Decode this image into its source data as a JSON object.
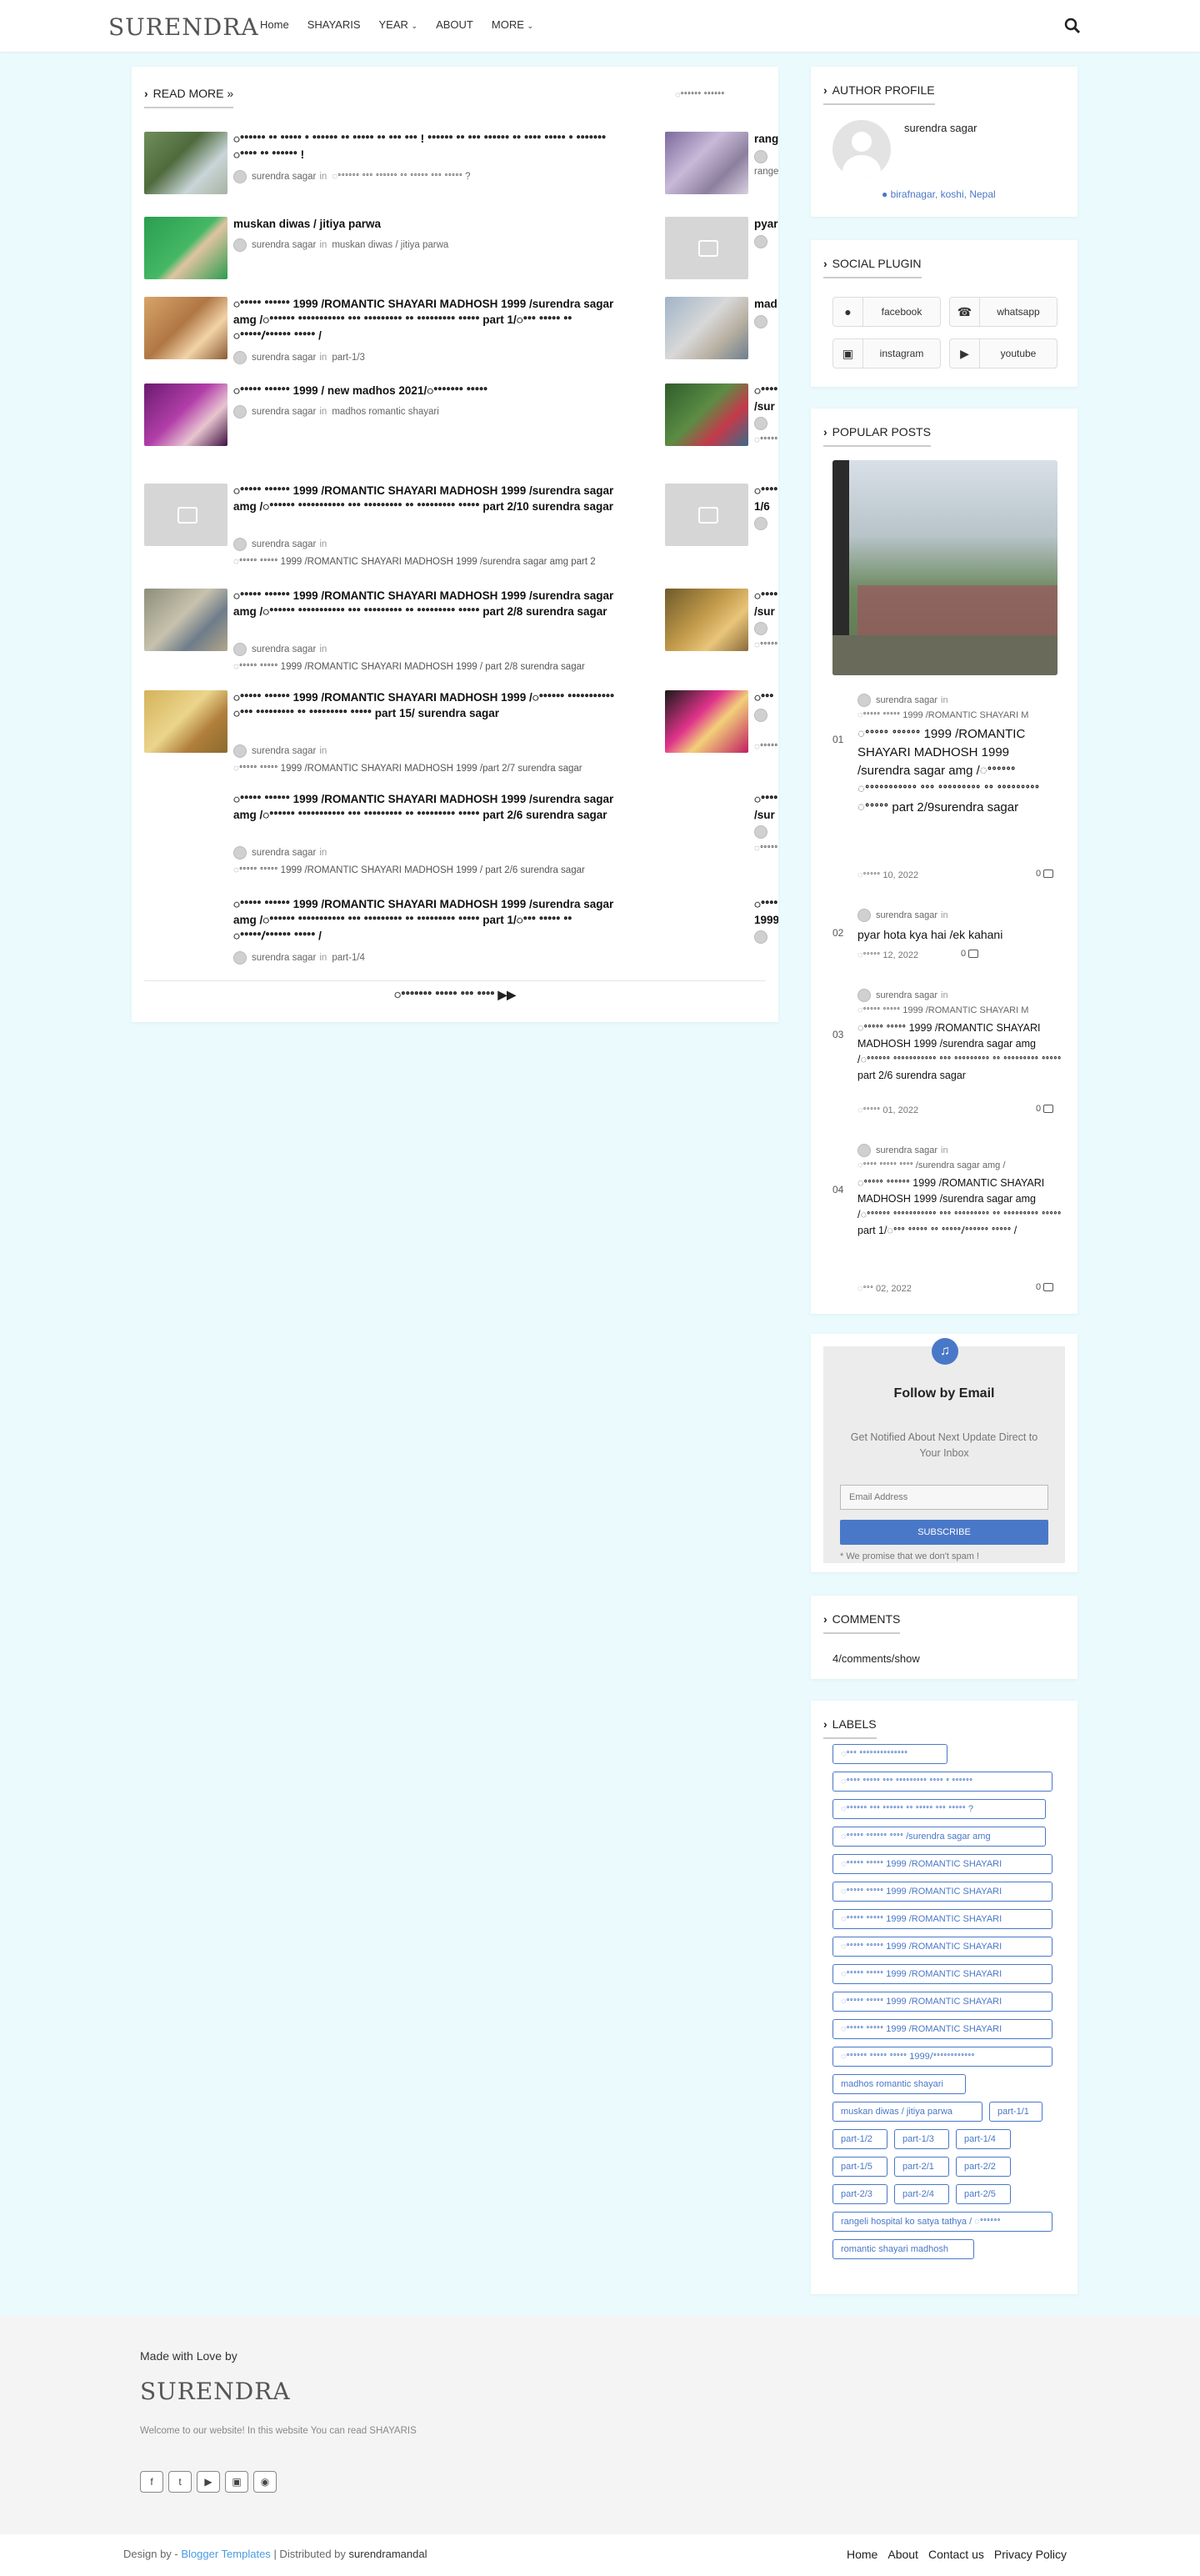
{
  "header": {
    "logo": "SURENDRA",
    "nav": [
      "Home",
      "SHAYARIS",
      "YEAR",
      "ABOUT",
      "MORE"
    ],
    "nav_has_dropdown": [
      false,
      false,
      true,
      false,
      true
    ]
  },
  "main": {
    "section_title": "READ MORE »",
    "section_link": "ꢀꢀꢀꢀꢀꢀ ꢀꢀꢀꢀꢀꢀ",
    "left_posts": [
      {
        "title": "ꢀꢀꢀꢀꢀꢀ ꢀꢀ ꢀꢀꢀꢀꢀ ꢀ ꢀꢀꢀꢀꢀꢀ ꢀꢀ ꢀꢀꢀꢀꢀ ꢀꢀ ꢀꢀꢀ ꢀꢀꢀ ! ꢀꢀꢀꢀꢀꢀ ꢀꢀ ꢀꢀꢀ ꢀꢀꢀꢀꢀꢀ ꢀꢀ ꢀꢀꢀꢀ ꢀꢀꢀꢀꢀ ꢀ ꢀꢀꢀꢀꢀꢀꢀ ꢀꢀꢀꢀ ꢀꢀ ꢀꢀꢀꢀꢀꢀ !",
        "author": "surendra sagar",
        "label": "ꢀꢀꢀꢀꢀꢀ ꢀꢀꢀ ꢀꢀꢀꢀꢀꢀ ꢀꢀ ꢀꢀꢀꢀꢀ ꢀꢀꢀ ꢀꢀꢀꢀꢀ ?"
      },
      {
        "title": "muskan diwas / jitiya parwa",
        "author": "surendra sagar",
        "label": "muskan diwas / jitiya parwa"
      },
      {
        "title": "ꢀꢀꢀꢀꢀ ꢀꢀꢀꢀꢀꢀ 1999 /ROMANTIC SHAYARI MADHOSH 1999 /surendra sagar amg /ꢀꢀꢀꢀꢀꢀ ꢀꢀꢀꢀꢀꢀꢀꢀꢀꢀꢀ ꢀꢀꢀ ꢀꢀꢀꢀꢀꢀꢀꢀꢀ ꢀꢀ ꢀꢀꢀꢀꢀꢀꢀꢀꢀ ꢀꢀꢀꢀꢀ part 1/ꢀꢀꢀ ꢀꢀꢀꢀꢀ ꢀꢀ ꢀꢀꢀꢀꢀ/ꢀꢀꢀꢀꢀꢀ ꢀꢀꢀꢀꢀ /",
        "author": "surendra sagar",
        "label": "part-1/3"
      },
      {
        "title": "ꢀꢀꢀꢀꢀ ꢀꢀꢀꢀꢀꢀ 1999 / new madhos 2021/ꢀꢀꢀꢀꢀꢀꢀ ꢀꢀꢀꢀꢀ",
        "author": "surendra sagar",
        "label": "madhos romantic shayari"
      },
      {
        "title": "ꢀꢀꢀꢀꢀ ꢀꢀꢀꢀꢀꢀ 1999 /ROMANTIC SHAYARI MADHOSH 1999 /surendra sagar amg /ꢀꢀꢀꢀꢀꢀ ꢀꢀꢀꢀꢀꢀꢀꢀꢀꢀꢀ ꢀꢀꢀ ꢀꢀꢀꢀꢀꢀꢀꢀꢀ ꢀꢀ ꢀꢀꢀꢀꢀꢀꢀꢀꢀ ꢀꢀꢀꢀꢀ part 2/10 surendra sagar",
        "author": "surendra sagar",
        "label": "ꢀꢀꢀꢀꢀ ꢀꢀꢀꢀꢀ 1999 /ROMANTIC SHAYARI MADHOSH 1999 /surendra sagar amg part 2"
      },
      {
        "title": "ꢀꢀꢀꢀꢀ ꢀꢀꢀꢀꢀꢀ 1999 /ROMANTIC SHAYARI MADHOSH 1999 /surendra sagar amg /ꢀꢀꢀꢀꢀꢀ ꢀꢀꢀꢀꢀꢀꢀꢀꢀꢀꢀ ꢀꢀꢀ ꢀꢀꢀꢀꢀꢀꢀꢀꢀ ꢀꢀ ꢀꢀꢀꢀꢀꢀꢀꢀꢀ ꢀꢀꢀꢀꢀ part 2/8 surendra sagar",
        "author": "surendra sagar",
        "label": "ꢀꢀꢀꢀꢀ ꢀꢀꢀꢀꢀ 1999 /ROMANTIC SHAYARI MADHOSH 1999 / part 2/8 surendra sagar"
      },
      {
        "title": "ꢀꢀꢀꢀꢀ ꢀꢀꢀꢀꢀꢀ 1999 /ROMANTIC SHAYARI MADHOSH 1999 /ꢀꢀꢀꢀꢀꢀ ꢀꢀꢀꢀꢀꢀꢀꢀꢀꢀꢀ ꢀꢀꢀ ꢀꢀꢀꢀꢀꢀꢀꢀꢀ ꢀꢀ ꢀꢀꢀꢀꢀꢀꢀꢀꢀ ꢀꢀꢀꢀꢀ part 15/ surendra sagar",
        "author": "surendra sagar",
        "label": "ꢀꢀꢀꢀꢀ ꢀꢀꢀꢀꢀ 1999 /ROMANTIC SHAYARI MADHOSH 1999 /part 2/7 surendra sagar"
      },
      {
        "title": "ꢀꢀꢀꢀꢀ ꢀꢀꢀꢀꢀꢀ 1999 /ROMANTIC SHAYARI MADHOSH 1999 /surendra sagar amg /ꢀꢀꢀꢀꢀꢀ ꢀꢀꢀꢀꢀꢀꢀꢀꢀꢀꢀ ꢀꢀꢀ ꢀꢀꢀꢀꢀꢀꢀꢀꢀ ꢀꢀ ꢀꢀꢀꢀꢀꢀꢀꢀꢀ ꢀꢀꢀꢀꢀ part 2/6 surendra sagar",
        "author": "surendra sagar",
        "label": "ꢀꢀꢀꢀꢀ ꢀꢀꢀꢀꢀ 1999 /ROMANTIC SHAYARI MADHOSH 1999 / part 2/6 surendra sagar"
      },
      {
        "title": "ꢀꢀꢀꢀꢀ ꢀꢀꢀꢀꢀꢀ 1999 /ROMANTIC SHAYARI MADHOSH 1999 /surendra sagar amg /ꢀꢀꢀꢀꢀꢀ ꢀꢀꢀꢀꢀꢀꢀꢀꢀꢀꢀ ꢀꢀꢀ ꢀꢀꢀꢀꢀꢀꢀꢀꢀ ꢀꢀ ꢀꢀꢀꢀꢀꢀꢀꢀꢀ ꢀꢀꢀꢀꢀ part 1/ꢀꢀꢀ ꢀꢀꢀꢀꢀ ꢀꢀ ꢀꢀꢀꢀꢀ/ꢀꢀꢀꢀꢀꢀ ꢀꢀꢀꢀꢀ /",
        "author": "surendra sagar",
        "label": "part-1/4"
      }
    ],
    "right_posts": [
      {
        "title": "rang",
        "meta": "rangeli",
        "label": ""
      },
      {
        "title": "pyar",
        "meta": "",
        "label": ""
      },
      {
        "title": "mad",
        "meta": "",
        "label": ""
      },
      {
        "title": "ꢀꢀꢀꢀ /sur",
        "meta": "",
        "label": "ꢀꢀꢀꢀꢀ"
      },
      {
        "title": "ꢀꢀꢀꢀ 1/6",
        "meta": "",
        "label": ""
      },
      {
        "title": "ꢀꢀꢀꢀ /sur",
        "meta": "",
        "label": "ꢀꢀꢀꢀꢀ"
      },
      {
        "title": "ꢀꢀꢀ",
        "meta": "",
        "label": "ꢀꢀꢀꢀꢀ"
      },
      {
        "title": "ꢀꢀꢀꢀ /sur",
        "meta": "",
        "label": "ꢀꢀꢀꢀꢀ"
      },
      {
        "title": "ꢀꢀꢀꢀ 1999",
        "meta": "",
        "label": ""
      }
    ],
    "in_word": "in",
    "more_button": "ꢀꢀꢀꢀꢀꢀꢀ ꢀꢀꢀꢀꢀ ꢀꢀꢀ ꢀꢀꢀꢀ"
  },
  "sidebar": {
    "author_profile": {
      "title": "AUTHOR PROFILE",
      "name": "surendra sagar",
      "location": "birafnagar, koshi, Nepal"
    },
    "social_plugin": {
      "title": "SOCIAL PLUGIN",
      "buttons": [
        "facebook",
        "whatsapp",
        "instagram",
        "youtube"
      ]
    },
    "popular_posts": {
      "title": "POPULAR POSTS",
      "items": [
        {
          "num": "01",
          "author": "surendra sagar",
          "label": "ꢀꢀꢀꢀꢀ ꢀꢀꢀꢀꢀ 1999 /ROMANTIC SHAYARI M",
          "title": "ꢀꢀꢀꢀꢀ ꢀꢀꢀꢀꢀꢀ 1999 /ROMANTIC SHAYARI MADHOSH 1999 /surendra sagar amg /ꢀꢀꢀꢀꢀꢀ ꢀꢀꢀꢀꢀꢀꢀꢀꢀꢀꢀ ꢀꢀꢀ ꢀꢀꢀꢀꢀꢀꢀꢀꢀ ꢀꢀ ꢀꢀꢀꢀꢀꢀꢀꢀꢀ ꢀꢀꢀꢀꢀ part 2/9surendra sagar",
          "date": "ꢀꢀꢀꢀꢀ 10, 2022",
          "comments": "0"
        },
        {
          "num": "02",
          "author": "surendra sagar",
          "label": "",
          "title": "pyar hota kya hai /ek kahani",
          "date": "ꢀꢀꢀꢀꢀ 12, 2022",
          "comments": "0"
        },
        {
          "num": "03",
          "author": "surendra sagar",
          "label": "ꢀꢀꢀꢀꢀ ꢀꢀꢀꢀꢀ 1999 /ROMANTIC SHAYARI M",
          "title": "ꢀꢀꢀꢀꢀ ꢀꢀꢀꢀꢀ 1999 /ROMANTIC SHAYARI MADHOSH 1999 /surendra sagar amg /ꢀꢀꢀꢀꢀꢀ ꢀꢀꢀꢀꢀꢀꢀꢀꢀꢀꢀ ꢀꢀꢀ ꢀꢀꢀꢀꢀꢀꢀꢀꢀ ꢀꢀ ꢀꢀꢀꢀꢀꢀꢀꢀꢀ ꢀꢀꢀꢀꢀ part 2/6 surendra sagar",
          "date": "ꢀꢀꢀꢀꢀ 01, 2022",
          "comments": "0"
        },
        {
          "num": "04",
          "author": "surendra sagar",
          "label": "ꢀꢀꢀꢀ ꢀꢀꢀꢀꢀ ꢀꢀꢀꢀ /surendra sagar amg /",
          "title": "ꢀꢀꢀꢀꢀ ꢀꢀꢀꢀꢀꢀ 1999 /ROMANTIC SHAYARI MADHOSH 1999 /surendra sagar amg /ꢀꢀꢀꢀꢀꢀ ꢀꢀꢀꢀꢀꢀꢀꢀꢀꢀꢀ ꢀꢀꢀ ꢀꢀꢀꢀꢀꢀꢀꢀꢀ ꢀꢀ ꢀꢀꢀꢀꢀꢀꢀꢀꢀ ꢀꢀꢀꢀꢀ part 1/ꢀꢀꢀ ꢀꢀꢀꢀꢀ ꢀꢀ ꢀꢀꢀꢀꢀ/ꢀꢀꢀꢀꢀꢀ ꢀꢀꢀꢀꢀ /",
          "date": "ꢀꢀꢀ 02, 2022",
          "comments": "0"
        }
      ]
    },
    "follow": {
      "title": "Follow by Email",
      "subtitle": "Get Notified About Next Update Direct to Your Inbox",
      "placeholder": "Email Address",
      "button": "SUBSCRIBE",
      "note": "* We promise that we don't spam !"
    },
    "comments": {
      "title": "COMMENTS",
      "body": "4/comments/show"
    },
    "labels": {
      "title": "LABELS",
      "tags": [
        "ꢀꢀꢀ ꢀꢀꢀꢀꢀꢀꢀꢀꢀꢀꢀꢀꢀꢀ",
        "ꢀꢀꢀꢀ ꢀꢀꢀꢀꢀ ꢀꢀꢀ ꢀꢀꢀꢀꢀꢀꢀꢀꢀ ꢀꢀꢀꢀ ꢀ ꢀꢀꢀꢀꢀꢀ",
        "ꢀꢀꢀꢀꢀꢀ ꢀꢀꢀ ꢀꢀꢀꢀꢀꢀ ꢀꢀ ꢀꢀꢀꢀꢀ ꢀꢀꢀ ꢀꢀꢀꢀꢀ ?",
        "ꢀꢀꢀꢀꢀ ꢀꢀꢀꢀꢀꢀ ꢀꢀꢀꢀ /surendra sagar amg",
        "ꢀꢀꢀꢀꢀ ꢀꢀꢀꢀꢀ 1999 /ROMANTIC SHAYARI",
        "ꢀꢀꢀꢀꢀ ꢀꢀꢀꢀꢀ 1999 /ROMANTIC SHAYARI",
        "ꢀꢀꢀꢀꢀ ꢀꢀꢀꢀꢀ 1999 /ROMANTIC SHAYARI",
        "ꢀꢀꢀꢀꢀ ꢀꢀꢀꢀꢀ 1999 /ROMANTIC SHAYARI",
        "ꢀꢀꢀꢀꢀ ꢀꢀꢀꢀꢀ 1999 /ROMANTIC SHAYARI",
        "ꢀꢀꢀꢀꢀ ꢀꢀꢀꢀꢀ 1999 /ROMANTIC SHAYARI",
        "ꢀꢀꢀꢀꢀ ꢀꢀꢀꢀꢀ 1999 /ROMANTIC SHAYARI",
        "ꢀꢀꢀꢀꢀꢀ ꢀꢀꢀꢀꢀ ꢀꢀꢀꢀꢀ 1999/ꢀꢀꢀꢀꢀꢀꢀꢀꢀꢀꢀꢀ",
        "madhos romantic shayari",
        "muskan diwas / jitiya parwa",
        "part-1/1",
        "part-1/2",
        "part-1/3",
        "part-1/4",
        "part-1/5",
        "part-2/1",
        "part-2/2",
        "part-2/3",
        "part-2/4",
        "part-2/5",
        "rangeli hospital ko satya tathya / ꢀꢀꢀꢀꢀꢀ",
        "romantic shayari madhosh"
      ]
    }
  },
  "footer": {
    "made_with": "Made with Love by",
    "brand": "SURENDRA",
    "about": "Welcome to our website! In this website You can read SHAYARIS",
    "icons": [
      "facebook-icon",
      "twitter-icon",
      "youtube-icon",
      "instagram-icon",
      "reddit-icon"
    ],
    "design_by": "Design by -",
    "blogger_templates": "Blogger Templates",
    "distributed_by": "| Distributed by",
    "distributor": "surendramandal",
    "links": [
      "Home",
      "About",
      "Contact us",
      "Privacy Policy"
    ]
  },
  "colors": {
    "accent": "#4a78c8",
    "background": "#eafafd",
    "footer": "#f4f4f4"
  }
}
